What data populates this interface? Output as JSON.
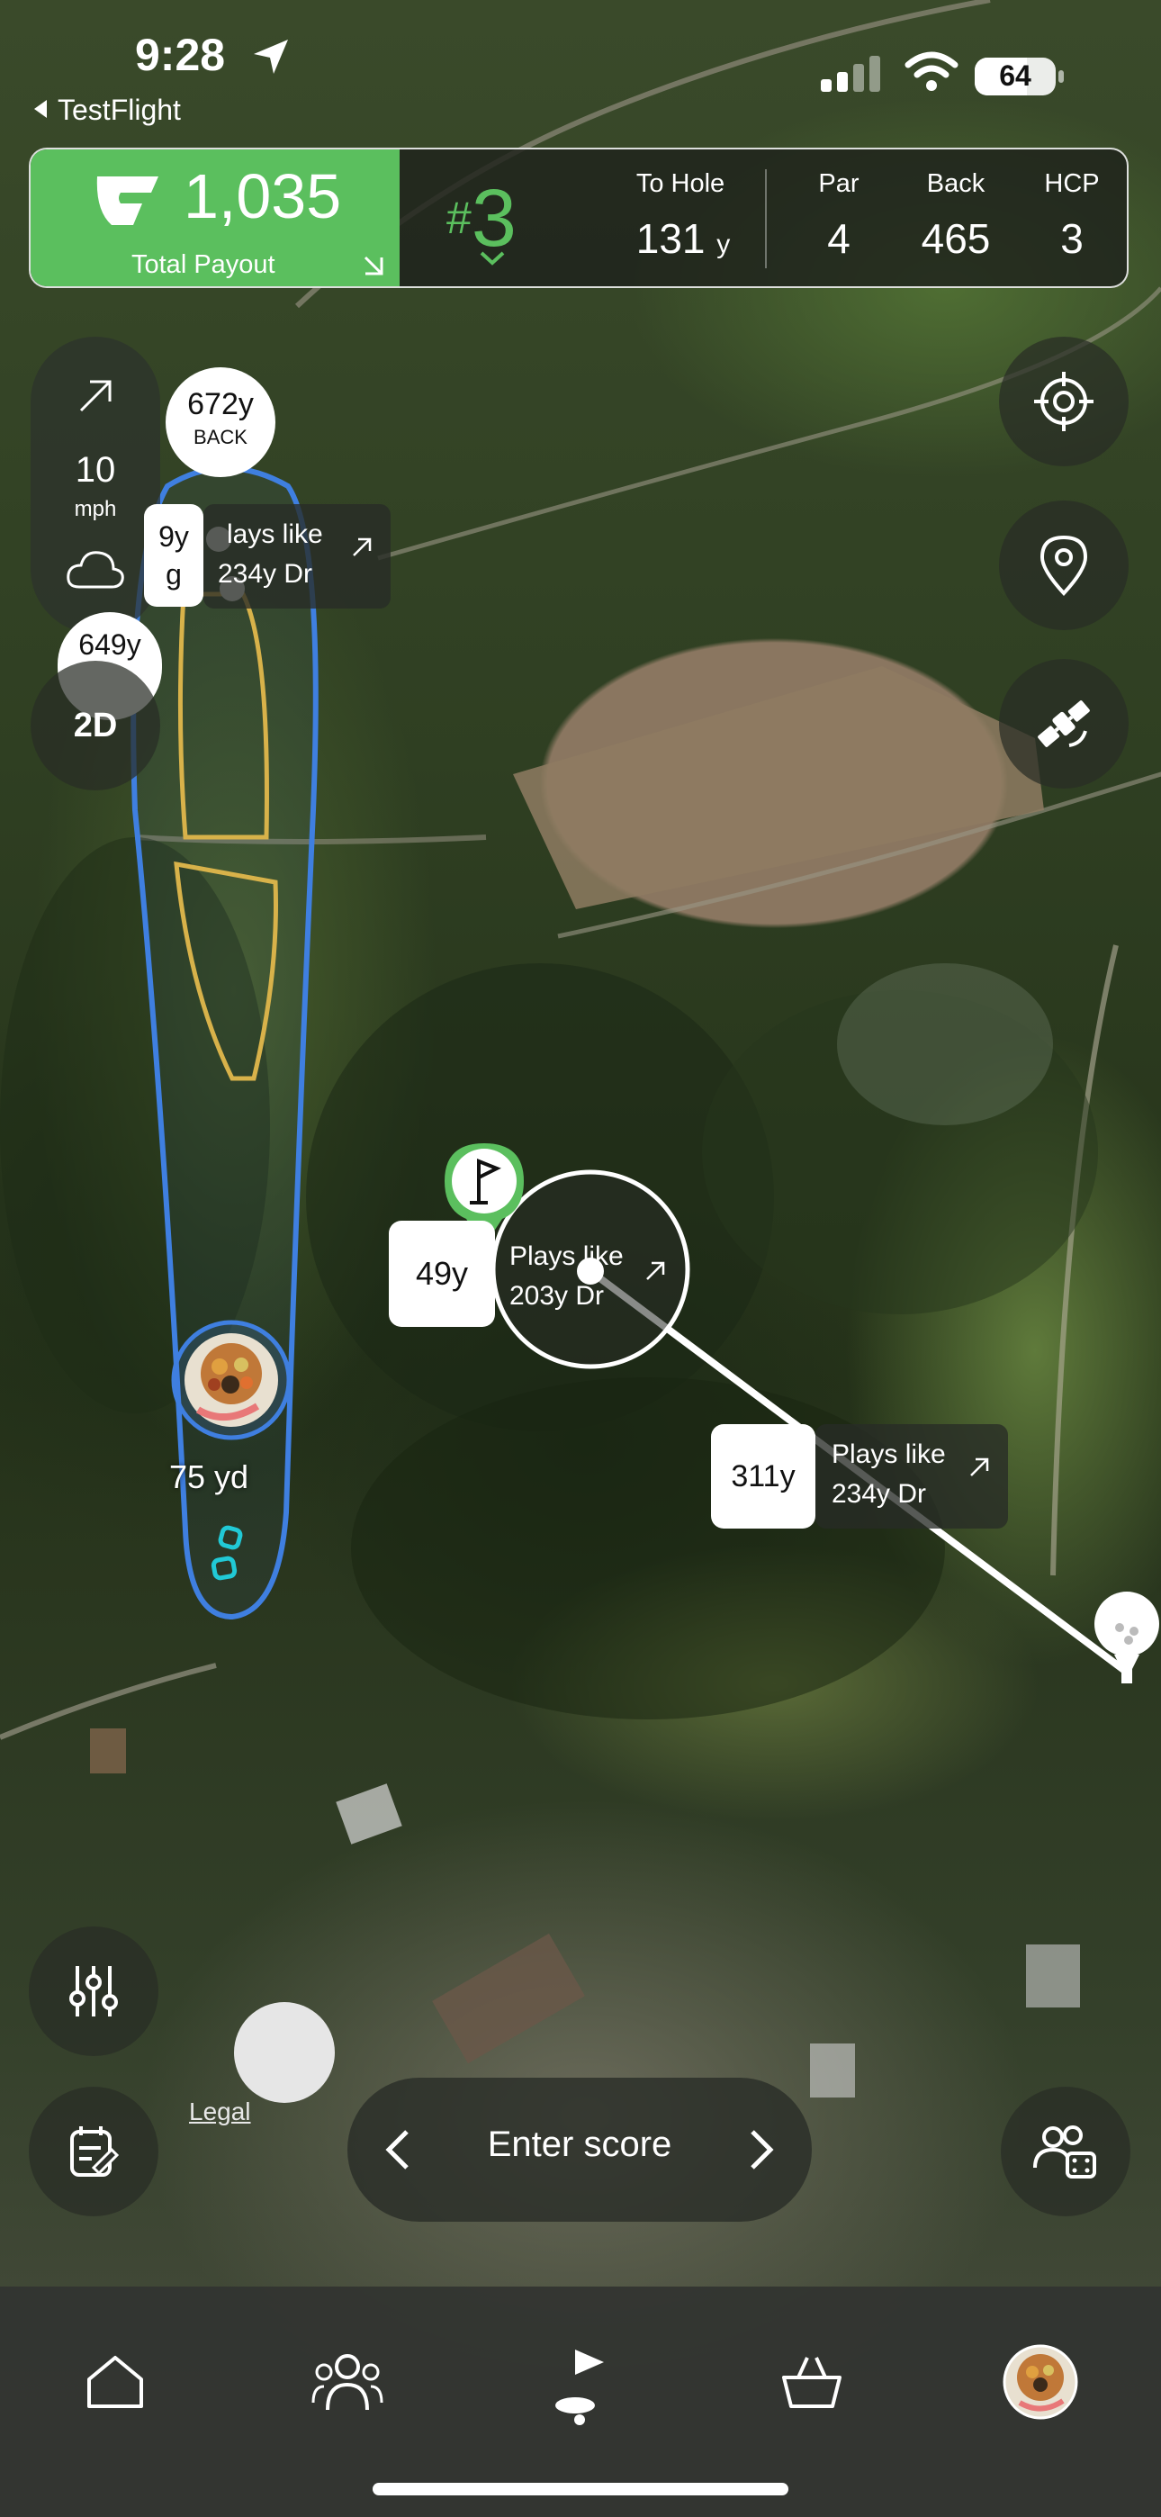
{
  "status_bar": {
    "time": "9:28",
    "back_app": "TestFlight",
    "battery": "64"
  },
  "topbar": {
    "payout_value": "1,035",
    "payout_label": "Total Payout",
    "hole_hash": "#",
    "hole_number": "3",
    "to_hole_label": "To Hole",
    "to_hole_value": "131",
    "to_hole_unit": "y",
    "par_label": "Par",
    "par_value": "4",
    "back_label": "Back",
    "back_value": "465",
    "hcp_label": "HCP",
    "hcp_value": "3"
  },
  "wind": {
    "speed": "10",
    "unit": "mph"
  },
  "view_toggle": "2D",
  "map": {
    "back_bubble_value": "672y",
    "back_bubble_label": "BACK",
    "partial_bubble_value": "649y",
    "partial_card_left_top": "9y",
    "partial_card_left_bottom": "g",
    "partial_card_line1": "lays like",
    "partial_card_line2": "234y  Dr",
    "pin_distance": "49y",
    "pin_plays_like_line1": "Plays like",
    "pin_plays_like_line2": "203y  Dr",
    "tee_distance": "311y",
    "tee_plays_like_line1": "Plays like",
    "tee_plays_like_line2": "234y  Dr",
    "player_distance": "75 yd",
    "legal": "Legal"
  },
  "bottom": {
    "enter_score": "Enter score"
  },
  "tabs": [
    "home",
    "friends",
    "play",
    "shop",
    "profile"
  ],
  "colors": {
    "accent_green": "#5bbf5e",
    "route_blue": "#3f7fe0",
    "hazard_yellow": "#d8b24a",
    "marker_cyan": "#21c9d6"
  }
}
